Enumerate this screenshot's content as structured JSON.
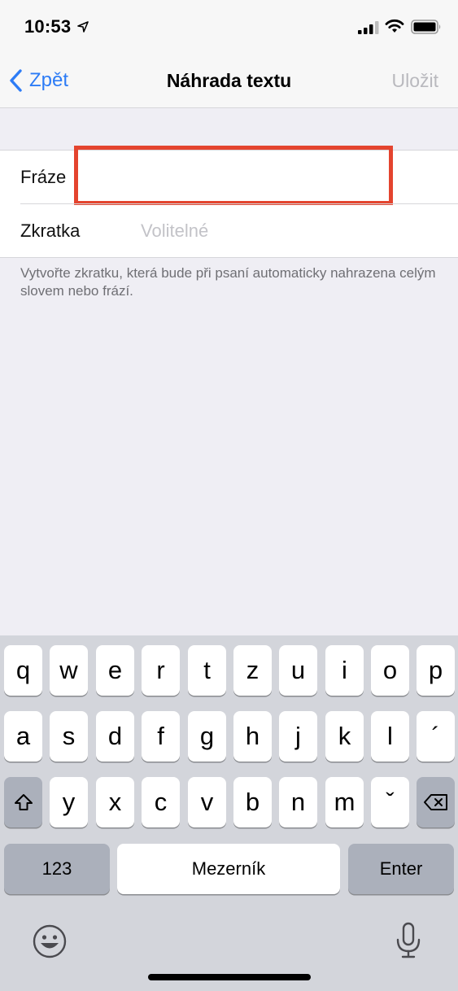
{
  "status_bar": {
    "time": "10:53"
  },
  "nav": {
    "back_label": "Zpět",
    "title": "Náhrada textu",
    "save_label": "Uložit"
  },
  "form": {
    "phrase_label": "Fráze",
    "phrase_value": "",
    "shortcut_label": "Zkratka",
    "shortcut_placeholder": "Volitelné",
    "footnote": "Vytvořte zkratku, která bude při psaní automaticky nahrazena celým slovem nebo frází."
  },
  "keyboard": {
    "row1": [
      "q",
      "w",
      "e",
      "r",
      "t",
      "z",
      "u",
      "i",
      "o",
      "p"
    ],
    "row2": [
      "a",
      "s",
      "d",
      "f",
      "g",
      "h",
      "j",
      "k",
      "l",
      "´"
    ],
    "row3": [
      "y",
      "x",
      "c",
      "v",
      "b",
      "n",
      "m",
      "ˇ"
    ],
    "numbers_label": "123",
    "space_label": "Mezerník",
    "enter_label": "Enter"
  },
  "colors": {
    "accent": "#2d7cf6",
    "highlight": "#e4442e"
  }
}
